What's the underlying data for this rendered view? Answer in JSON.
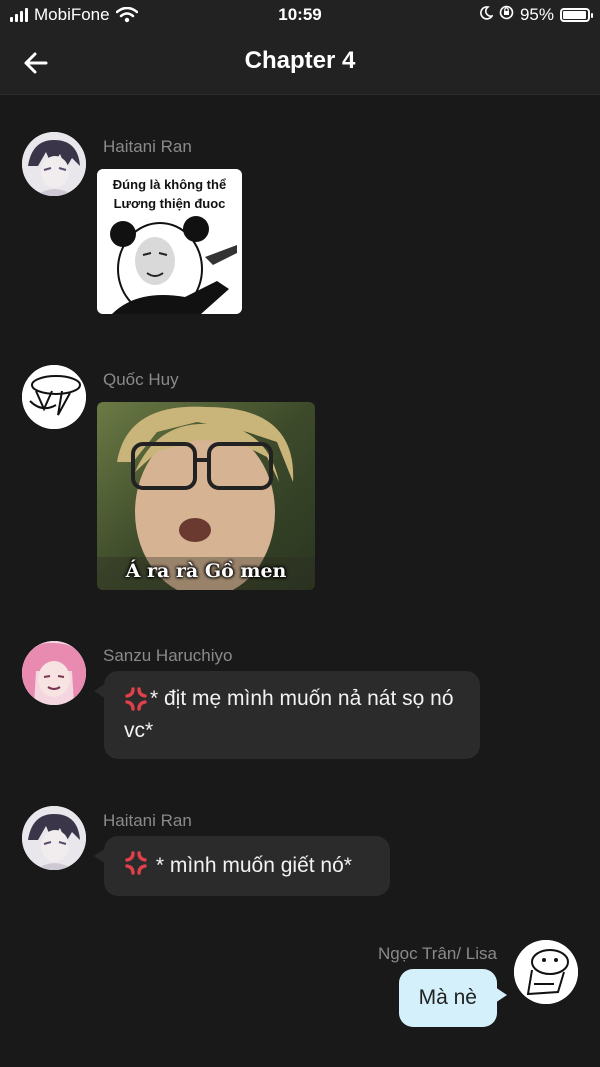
{
  "status": {
    "carrier": "MobiFone",
    "time": "10:59",
    "battery": "95%",
    "battery_level": 0.95
  },
  "header": {
    "title": "Chapter 4"
  },
  "messages": [
    {
      "sender": "Haitani Ran",
      "type": "sticker",
      "sticker_text": "Đúng là không thể Lương thiện đuoc"
    },
    {
      "sender": "Quốc Huy",
      "type": "image",
      "caption": "Á ra rà Gồ men"
    },
    {
      "sender": "Sanzu Haruchiyo",
      "type": "text",
      "text": "* địt mẹ mình muốn nả nát sọ nó vc*"
    },
    {
      "sender": "Haitani Ran",
      "type": "text",
      "text": "* mình muốn giết nó*"
    },
    {
      "sender": "Ngọc Trân/ Lisa",
      "type": "text",
      "text": "Mà nè"
    }
  ],
  "icons": {
    "back": "arrow-left-icon",
    "emoji": "anger-symbol-icon",
    "signal": "signal-icon",
    "wifi": "wifi-icon",
    "moon": "moon-icon",
    "lock": "rotation-lock-icon",
    "battery": "battery-icon"
  },
  "colors": {
    "background": "#191919",
    "bubble_other": "#2b2b2b",
    "bubble_me": "#d4f0fb",
    "sender_name": "#8a8a8a",
    "anger_icon": "#e0404a"
  }
}
